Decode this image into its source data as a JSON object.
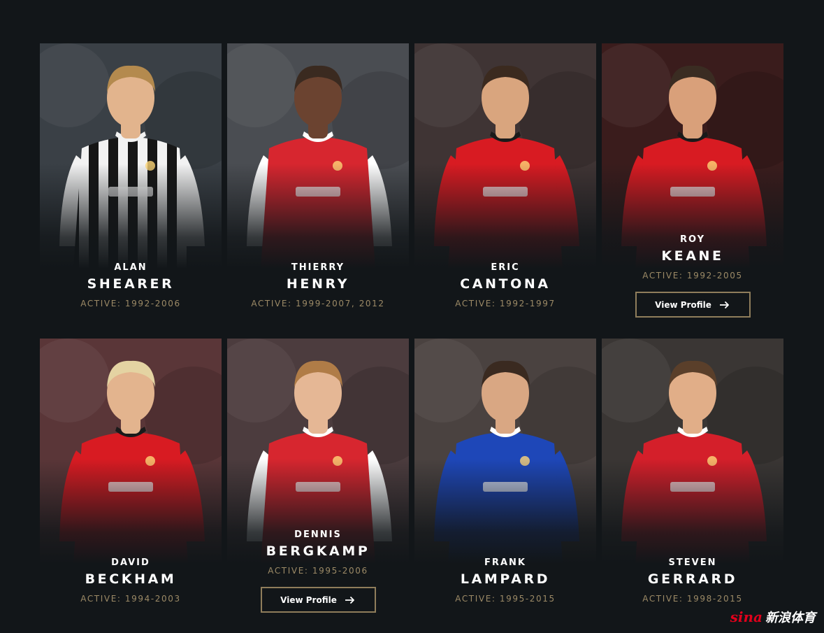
{
  "players": [
    {
      "first": "ALAN",
      "last": "SHEARER",
      "active": "ACTIVE: 1992-2006",
      "kit": "newcastle",
      "skin": "#e2b48d",
      "hair": "#b48a4e",
      "bg": "#3a4046",
      "hover": false
    },
    {
      "first": "THIERRY",
      "last": "HENRY",
      "active": "ACTIVE: 1999-2007, 2012",
      "kit": "arsenal",
      "skin": "#6b4330",
      "hair": "#3a2a20",
      "bg": "#4a4d52",
      "hover": false
    },
    {
      "first": "ERIC",
      "last": "CANTONA",
      "active": "ACTIVE: 1992-1997",
      "kit": "manutd",
      "skin": "#d9a57e",
      "hair": "#3b2a1f",
      "bg": "#3f3434",
      "hover": false
    },
    {
      "first": "ROY",
      "last": "KEANE",
      "active": "ACTIVE: 1992-2005",
      "kit": "manutd",
      "skin": "#d9a07a",
      "hair": "#3a2c22",
      "bg": "#3a1c1c",
      "hover": true
    },
    {
      "first": "DAVID",
      "last": "BECKHAM",
      "active": "ACTIVE: 1994-2003",
      "kit": "manutd",
      "skin": "#e3b48e",
      "hair": "#e4d3a2",
      "bg": "#5a3638",
      "hover": false
    },
    {
      "first": "DENNIS",
      "last": "BERGKAMP",
      "active": "ACTIVE: 1995-2006",
      "kit": "arsenal",
      "skin": "#e5b795",
      "hair": "#b07c47",
      "bg": "#4c3c3e",
      "hover": true
    },
    {
      "first": "FRANK",
      "last": "LAMPARD",
      "active": "ACTIVE: 1995-2015",
      "kit": "chelsea",
      "skin": "#d9a783",
      "hair": "#3a2a20",
      "bg": "#4a4240",
      "hover": false
    },
    {
      "first": "STEVEN",
      "last": "GERRARD",
      "active": "ACTIVE: 1998-2015",
      "kit": "liverpool",
      "skin": "#e1ae88",
      "hair": "#5a3f2a",
      "bg": "#3a3634",
      "hover": false
    }
  ],
  "button_label": "View Profile",
  "watermark": {
    "logo": "sina",
    "text": "新浪体育"
  },
  "colors": {
    "background": "#121619",
    "accent": "#9c8a66",
    "button_border": "#8f7d5b"
  }
}
